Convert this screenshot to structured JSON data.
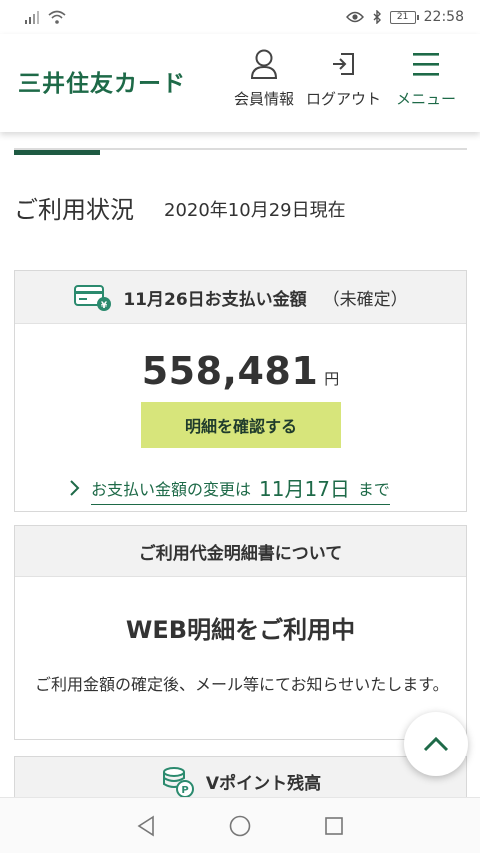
{
  "status_bar": {
    "time": "22:58",
    "battery": "21"
  },
  "header": {
    "logo": "三井住友カード",
    "nav": {
      "member_label": "会員情報",
      "logout_label": "ログアウト",
      "menu_label": "メニュー"
    }
  },
  "usage": {
    "title": "ご利用状況",
    "as_of": "2020年10月29日現在"
  },
  "payment_card": {
    "heading": "11月26日お支払い金額",
    "heading_note": "（未確定）",
    "amount": "558,481",
    "currency": "円",
    "detail_button": "明細を確認する",
    "change_link_prefix": "お支払い金額の変更は",
    "change_link_date": "11月17日",
    "change_link_suffix": "まで"
  },
  "statement_card": {
    "heading": "ご利用代金明細書について",
    "status_title": "WEB明細をご利用中",
    "description": "ご利用金額の確定後、メール等にてお知らせいたします。"
  },
  "points_card": {
    "heading": "Vポイント残高"
  },
  "colors": {
    "brand_green": "#1e6a48",
    "button_lime": "#d7e57b",
    "card_head_bg": "#f2f2f2"
  }
}
